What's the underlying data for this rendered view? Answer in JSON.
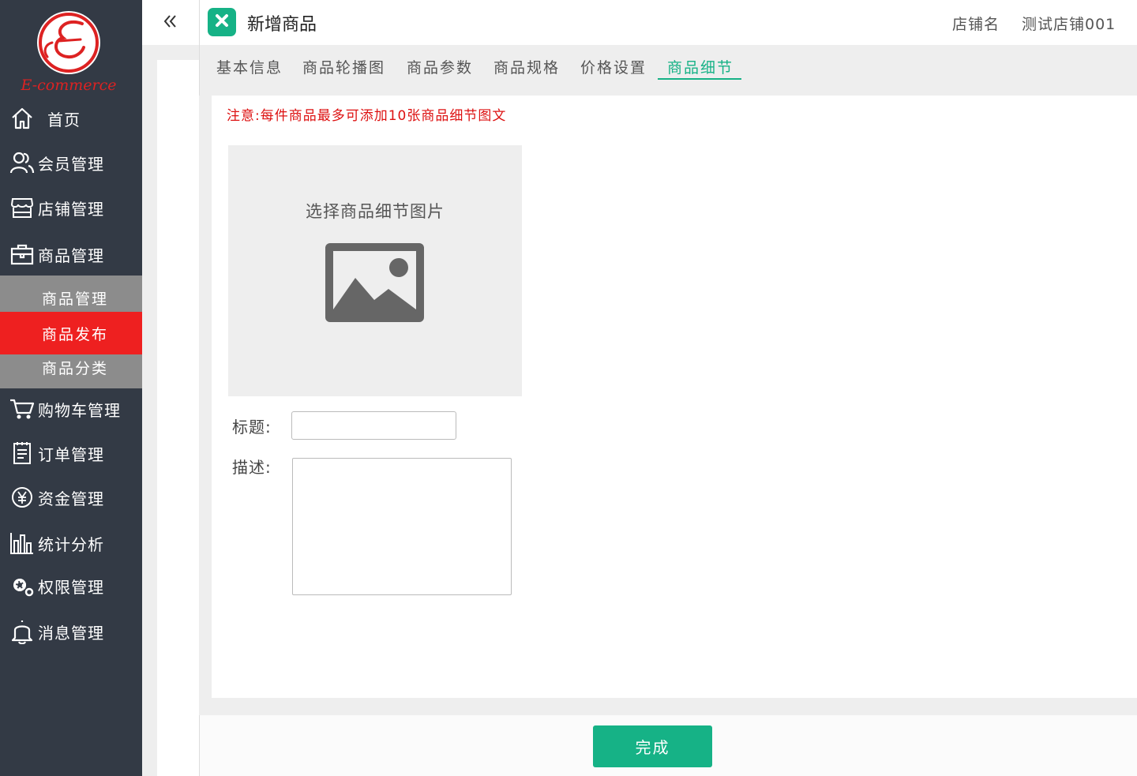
{
  "sidebar": {
    "logo_text": "E-commerce",
    "items": [
      {
        "label": "首页",
        "icon": "home-icon"
      },
      {
        "label": "会员管理",
        "icon": "users-icon"
      },
      {
        "label": "店铺管理",
        "icon": "store-icon"
      },
      {
        "label": "商品管理",
        "icon": "briefcase-icon"
      },
      {
        "label": "购物车管理",
        "icon": "cart-icon"
      },
      {
        "label": "订单管理",
        "icon": "order-icon"
      },
      {
        "label": "资金管理",
        "icon": "yen-icon"
      },
      {
        "label": "统计分析",
        "icon": "bar-chart-icon"
      },
      {
        "label": "权限管理",
        "icon": "gear-icon"
      },
      {
        "label": "消息管理",
        "icon": "bell-icon"
      }
    ],
    "sub_items": [
      {
        "label": "商品管理"
      },
      {
        "label": "商品发布",
        "active": true
      },
      {
        "label": "商品分类"
      }
    ]
  },
  "header": {
    "title": "新增商品",
    "shop_label": "店铺名",
    "shop_name": "测试店铺001"
  },
  "tabs": [
    {
      "label": "基本信息"
    },
    {
      "label": "商品轮播图"
    },
    {
      "label": "商品参数"
    },
    {
      "label": "商品规格"
    },
    {
      "label": "价格设置"
    },
    {
      "label": "商品细节",
      "active": true
    }
  ],
  "main": {
    "notice": "注意:每件商品最多可添加10张商品细节图文",
    "upload_text": "选择商品细节图片",
    "title_label": "标题:",
    "title_value": "",
    "desc_label": "描述:",
    "desc_value": ""
  },
  "footer": {
    "done_label": "完成"
  },
  "colors": {
    "sidebar_bg": "#333a45",
    "accent": "#16b286",
    "active_menu": "#ee2020",
    "notice": "#dd1111"
  }
}
